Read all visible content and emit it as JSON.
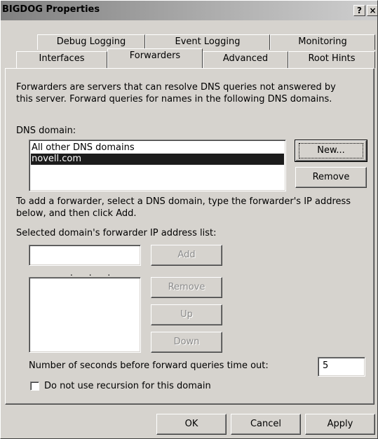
{
  "window": {
    "title": "BIGDOG Properties",
    "help_label": "?",
    "close_label": "×"
  },
  "tabs_row_back": [
    {
      "label": "Debug Logging"
    },
    {
      "label": "Event Logging"
    },
    {
      "label": "Monitoring"
    }
  ],
  "tabs_row_front": [
    {
      "label": "Interfaces"
    },
    {
      "label": "Forwarders",
      "active": true
    },
    {
      "label": "Advanced"
    },
    {
      "label": "Root Hints"
    }
  ],
  "forwarders": {
    "description_line1": "Forwarders are servers that can resolve DNS queries not answered by",
    "description_line2": "this server. Forward queries for names in the following DNS domains.",
    "dns_domain_label": "DNS domain:",
    "dns_domains": [
      {
        "name": "All other DNS domains",
        "selected": false
      },
      {
        "name": "novell.com",
        "selected": true
      }
    ],
    "new_button": "New...",
    "remove_domain_button": "Remove",
    "instruction_line1": "To add a forwarder, select a DNS domain, type the forwarder's IP address",
    "instruction_line2": "below, and then click Add.",
    "ip_list_label": "Selected domain's forwarder IP address list:",
    "ip_input_dots": ".      .      .",
    "add_button": "Add",
    "remove_ip_button": "Remove",
    "up_button": "Up",
    "down_button": "Down",
    "timeout_label": "Number of seconds before forward queries time out:",
    "timeout_value": "5",
    "no_recursion_label": "Do not use recursion for this domain",
    "no_recursion_checked": false
  },
  "footer": {
    "ok_button": "OK",
    "cancel_button": "Cancel",
    "apply_button": "Apply"
  }
}
